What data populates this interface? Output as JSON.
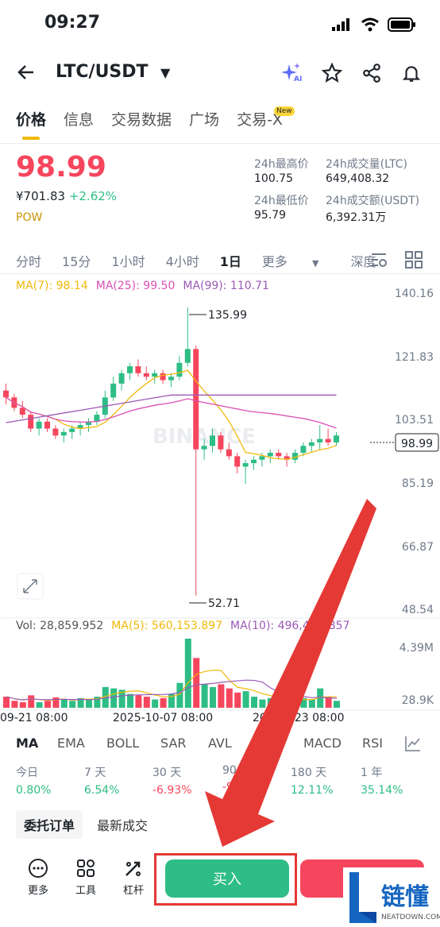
{
  "status": {
    "time": "09:27"
  },
  "header": {
    "pair": "LTC/USDT",
    "ai_label": "AI"
  },
  "tabs": [
    "价格",
    "信息",
    "交易数据",
    "广场",
    "交易-X"
  ],
  "new_badge": "New",
  "price": {
    "last": "98.99",
    "fiat": "¥701.83",
    "change": "+2.62%",
    "tag": "POW",
    "high_label": "24h最高价",
    "high": "100.75",
    "low_label": "24h最低价",
    "low": "95.79",
    "vol_label": "24h成交量(LTC)",
    "vol": "649,408.32",
    "amount_label": "24h成交额(USDT)",
    "amount": "6,392.31万"
  },
  "intervals": [
    "分时",
    "15分",
    "1小时",
    "4小时",
    "1日",
    "更多",
    "深度"
  ],
  "ma": {
    "ma7": "MA(7): 98.14",
    "ma25": "MA(25): 99.50",
    "ma99": "MA(99): 110.71"
  },
  "y_axis": [
    "140.16",
    "121.83",
    "103.51",
    "85.19",
    "66.87",
    "48.54"
  ],
  "price_tag": "98.99",
  "high_mark": "135.99",
  "low_mark": "52.71",
  "watermark": "BINANCE",
  "volume": {
    "vol": "Vol: 28,859.952",
    "ma5": "MA(5): 560,153.897",
    "ma10": "MA(10): 496,4",
    "ma10_tail": "857",
    "y_top": "4.39M",
    "y_bottom": "28.9K"
  },
  "x_axis": [
    "09-21 08:00",
    "2025-10-07 08:00",
    "20",
    "10-23 08:00"
  ],
  "indicators": [
    "MA",
    "EMA",
    "BOLL",
    "SAR",
    "AVL",
    "MACD",
    "RSI"
  ],
  "performance": [
    {
      "label": "今日",
      "value": "0.80%"
    },
    {
      "label": "7 天",
      "value": "6.54%"
    },
    {
      "label": "30 天",
      "value": "-6.93%"
    },
    {
      "label": "90",
      "value": "-9"
    },
    {
      "label": "180 天",
      "value": "12.11%"
    },
    {
      "label": "1 年",
      "value": "35.14%"
    }
  ],
  "orders": {
    "open": "委托订单",
    "trades": "最新成交"
  },
  "bottom": {
    "more": "更多",
    "tools": "工具",
    "leverage": "杠杆",
    "buy": "买入"
  },
  "brand": {
    "name": "链懂",
    "sub": "NEATDOWN.COM"
  },
  "colors": {
    "up": "#2ebd85",
    "down": "#f6465d",
    "accent": "#f0b90b",
    "arrow": "#e53935"
  },
  "chart_data": {
    "type": "candlestick",
    "ylim": [
      48.54,
      140.16
    ],
    "candles": [
      [
        112,
        114,
        108,
        110
      ],
      [
        110,
        111,
        106,
        107
      ],
      [
        107,
        109,
        104,
        105
      ],
      [
        105,
        106,
        100,
        101
      ],
      [
        101,
        104,
        99,
        103
      ],
      [
        103,
        104,
        100,
        101
      ],
      [
        101,
        102,
        98,
        99
      ],
      [
        99,
        101,
        97,
        100
      ],
      [
        100,
        102,
        98,
        101
      ],
      [
        101,
        103,
        99,
        102
      ],
      [
        102,
        104,
        100,
        103
      ],
      [
        103,
        106,
        102,
        105
      ],
      [
        105,
        112,
        104,
        110
      ],
      [
        110,
        116,
        109,
        114
      ],
      [
        114,
        118,
        112,
        117
      ],
      [
        117,
        120,
        115,
        119
      ],
      [
        119,
        121,
        116,
        117
      ],
      [
        117,
        119,
        115,
        116
      ],
      [
        116,
        118,
        114,
        117
      ],
      [
        117,
        118,
        114,
        115
      ],
      [
        115,
        117,
        113,
        116
      ],
      [
        116,
        122,
        115,
        120
      ],
      [
        120,
        136,
        119,
        124
      ],
      [
        124,
        125,
        52.71,
        95
      ],
      [
        95,
        98,
        92,
        96
      ],
      [
        96,
        101,
        94,
        99
      ],
      [
        99,
        100,
        94,
        95
      ],
      [
        95,
        97,
        92,
        93
      ],
      [
        93,
        94,
        88,
        90
      ],
      [
        90,
        92,
        85,
        91
      ],
      [
        91,
        93,
        89,
        92
      ],
      [
        92,
        94,
        90,
        93
      ],
      [
        93,
        95,
        91,
        94
      ],
      [
        94,
        95,
        92,
        93
      ],
      [
        93,
        94,
        90,
        92
      ],
      [
        92,
        95,
        91,
        94
      ],
      [
        94,
        97,
        93,
        96
      ],
      [
        96,
        98,
        94,
        97
      ],
      [
        97,
        102,
        95,
        98
      ],
      [
        98,
        101,
        96,
        97
      ],
      [
        97,
        100,
        96,
        99
      ]
    ],
    "volumes": [
      0.16,
      0.1,
      0.08,
      0.18,
      0.08,
      0.1,
      0.15,
      0.12,
      0.1,
      0.14,
      0.12,
      0.16,
      0.3,
      0.28,
      0.26,
      0.2,
      0.18,
      0.16,
      0.12,
      0.14,
      0.2,
      0.36,
      1.0,
      0.72,
      0.34,
      0.3,
      0.34,
      0.28,
      0.22,
      0.24,
      0.16,
      0.12,
      0.14,
      0.1,
      0.12,
      0.1,
      0.14,
      0.12,
      0.28,
      0.16,
      0.1
    ]
  }
}
